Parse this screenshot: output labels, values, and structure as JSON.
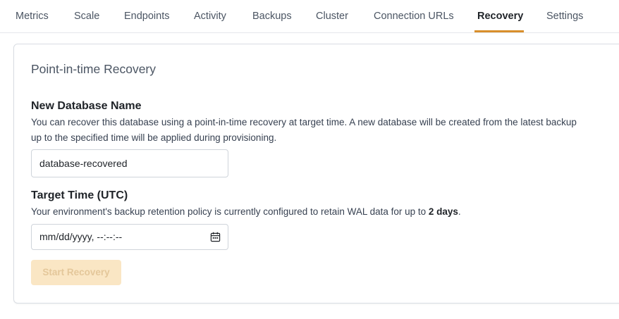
{
  "tabs": [
    {
      "label": "Metrics"
    },
    {
      "label": "Scale"
    },
    {
      "label": "Endpoints"
    },
    {
      "label": "Activity"
    },
    {
      "label": "Backups"
    },
    {
      "label": "Cluster"
    },
    {
      "label": "Connection URLs"
    },
    {
      "label": "Recovery",
      "active": true
    },
    {
      "label": "Settings"
    }
  ],
  "colors": {
    "accent": "#d98f2b",
    "button_bg": "#fae6c4",
    "button_text": "#e4c79a"
  },
  "recovery": {
    "title": "Point-in-time Recovery",
    "name_label": "New Database Name",
    "name_help_line1": "You can recover this database using a point-in-time recovery at target time. A new database will be created from the latest backup",
    "name_help_line2": "up to the specified time will be applied during provisioning.",
    "name_value": "database-recovered",
    "time_label": "Target Time (UTC)",
    "time_help_prefix": "Your environment's backup retention policy is currently configured to retain WAL data for up to ",
    "time_help_bold": "2 days",
    "time_help_suffix": ".",
    "time_placeholder": "mm/dd/yyyy, --:--:--",
    "calendar_icon": "calendar-icon",
    "start_button": "Start Recovery",
    "start_button_disabled": true
  }
}
